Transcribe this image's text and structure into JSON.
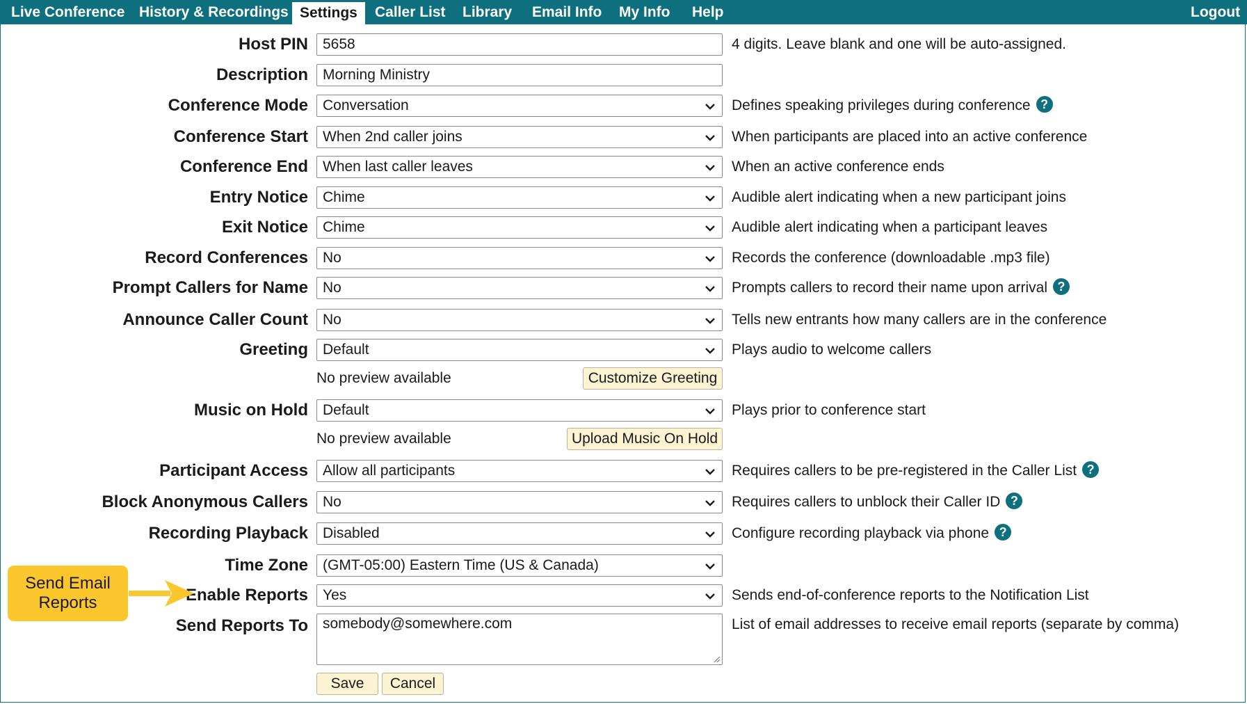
{
  "nav": {
    "items": [
      {
        "label": "Live Conference",
        "active": false
      },
      {
        "label": "History & Recordings",
        "active": false
      },
      {
        "label": "Settings",
        "active": true
      },
      {
        "label": "Caller List",
        "active": false
      },
      {
        "label": "Library",
        "active": false
      },
      {
        "label": "Email Info",
        "active": false
      },
      {
        "label": "My Info",
        "active": false
      },
      {
        "label": "Help",
        "active": false
      }
    ],
    "logout": "Logout"
  },
  "form": {
    "host_pin": {
      "label": "Host PIN",
      "value": "5658",
      "help": "4 digits. Leave blank and one will be auto-assigned."
    },
    "description": {
      "label": "Description",
      "value": "Morning Ministry"
    },
    "conference_mode": {
      "label": "Conference Mode",
      "value": "Conversation",
      "help": "Defines speaking privileges during conference"
    },
    "conference_start": {
      "label": "Conference Start",
      "value": "When 2nd caller joins",
      "help": "When participants are placed into an active conference"
    },
    "conference_end": {
      "label": "Conference End",
      "value": "When last caller leaves",
      "help": "When an active conference ends"
    },
    "entry_notice": {
      "label": "Entry Notice",
      "value": "Chime",
      "help": "Audible alert indicating when a new participant joins"
    },
    "exit_notice": {
      "label": "Exit Notice",
      "value": "Chime",
      "help": "Audible alert indicating when a participant leaves"
    },
    "record_conferences": {
      "label": "Record Conferences",
      "value": "No",
      "help": "Records the conference (downloadable .mp3 file)"
    },
    "prompt_callers": {
      "label": "Prompt Callers for Name",
      "value": "No",
      "help": "Prompts callers to record their name upon arrival"
    },
    "announce_count": {
      "label": "Announce Caller Count",
      "value": "No",
      "help": "Tells new entrants how many callers are in the conference"
    },
    "greeting": {
      "label": "Greeting",
      "value": "Default",
      "help": "Plays audio to welcome callers",
      "preview": "No preview available",
      "button": "Customize Greeting"
    },
    "music_on_hold": {
      "label": "Music on Hold",
      "value": "Default",
      "help": "Plays prior to conference start",
      "preview": "No preview available",
      "button": "Upload Music On Hold"
    },
    "participant_access": {
      "label": "Participant Access",
      "value": "Allow all participants",
      "help": "Requires callers to be pre-registered in the Caller List"
    },
    "block_anonymous": {
      "label": "Block Anonymous Callers",
      "value": "No",
      "help": "Requires callers to unblock their Caller ID"
    },
    "recording_playback": {
      "label": "Recording Playback",
      "value": "Disabled",
      "help": "Configure recording playback via phone"
    },
    "time_zone": {
      "label": "Time Zone",
      "value": "(GMT-05:00) Eastern Time (US & Canada)"
    },
    "enable_reports": {
      "label": "Enable Reports",
      "value": "Yes",
      "help": "Sends end-of-conference reports to the Notification List"
    },
    "send_reports_to": {
      "label": "Send Reports To",
      "value": "somebody@somewhere.com",
      "help": "List of email addresses to receive email reports (separate by comma)"
    },
    "save": "Save",
    "cancel": "Cancel"
  },
  "callout": {
    "line1": "Send Email",
    "line2": "Reports"
  },
  "colors": {
    "nav_bg": "#0e6f7f",
    "help_icon": "#0e6f7f",
    "callout": "#fcc62d",
    "button_bg": "#fbf3d2"
  }
}
